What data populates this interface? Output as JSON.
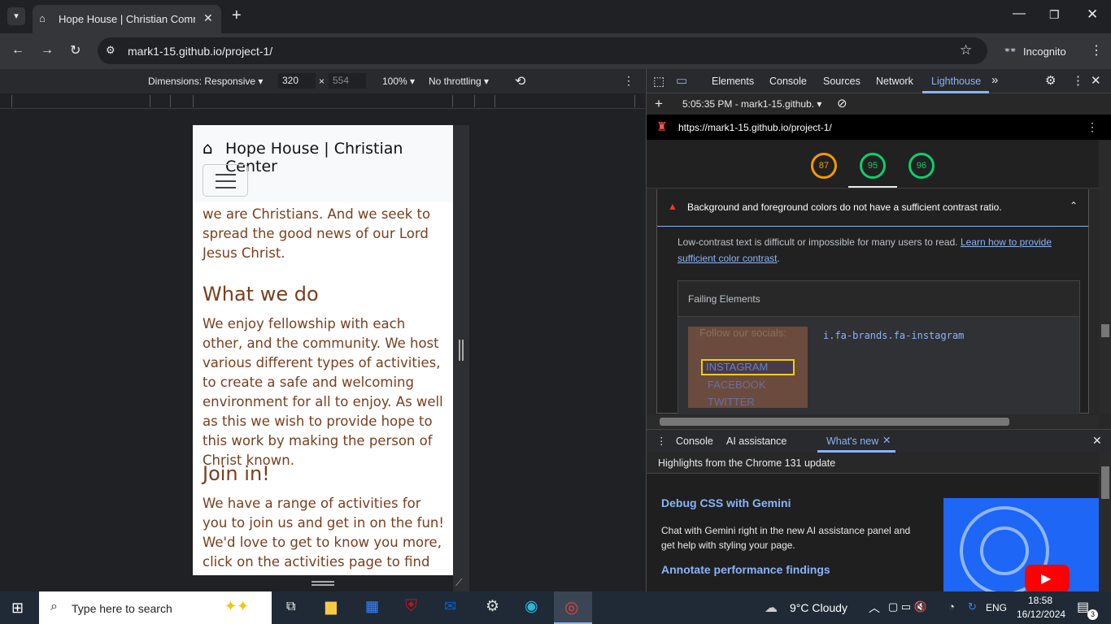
{
  "browser": {
    "tab_title": "Hope House | Christian Commu",
    "url": "mark1-15.github.io/project-1/",
    "incognito": "Incognito"
  },
  "devtoolbar": {
    "dimensions": "Dimensions: Responsive",
    "width": "320",
    "height": "554",
    "zoom": "100%",
    "throttle": "No throttling"
  },
  "site": {
    "brand": "Hope House | Christian Center",
    "p1": "do but with one difference, that is, we are Christians. And we seek to spread the good news of our Lord Jesus Christ.",
    "h2a": "What we do",
    "p2": "We enjoy fellowship with each other, and the community. We host various different types of activities, to create a safe and welcoming environment for all to enjoy. As well as this we wish to provide hope to this work by making the person of Christ known.",
    "h2b": "Join in!",
    "p3": "We have a range of activities for you to join us and get in on the fun! We'd love to get to know you more, click on the activities page to find out"
  },
  "devtools": {
    "tabs": [
      "Elements",
      "Console",
      "Sources",
      "Network",
      "Lighthouse"
    ],
    "report_time": "5:05:35 PM - mark1-15.github.",
    "report_url": "https://mark1-15.github.io/project-1/",
    "scores": [
      "87",
      "95",
      "96"
    ],
    "audit_title": "Background and foreground colors do not have a sufficient contrast ratio.",
    "audit_desc": "Low-contrast text is difficult or impossible for many users to read.",
    "audit_link": "Learn how to provide sufficient color contrast",
    "failing": "Failing Elements",
    "selector": "i.fa-brands.fa-instagram",
    "thumb_follow": "Follow our socials:",
    "thumb_insta": "INSTAGRAM",
    "thumb_fb": "FACEBOOK",
    "thumb_tw": "TWITTER"
  },
  "drawer": {
    "tabs": [
      "Console",
      "AI assistance",
      "What's new"
    ],
    "highlights": "Highlights from the Chrome 131 update",
    "h1": "Debug CSS with Gemini",
    "p1": "Chat with Gemini right in the new AI assistance panel and get help with styling your page.",
    "h2": "Annotate performance findings"
  },
  "taskbar": {
    "search": "Type here to search",
    "weather": "9°C  Cloudy",
    "lang": "ENG",
    "time": "18:58",
    "date": "16/12/2024",
    "badge": "3"
  },
  "colors": {
    "accent": "#8ab4f8",
    "brown": "#7a3e1d",
    "orange": "#f29900",
    "green": "#0cce6b"
  }
}
